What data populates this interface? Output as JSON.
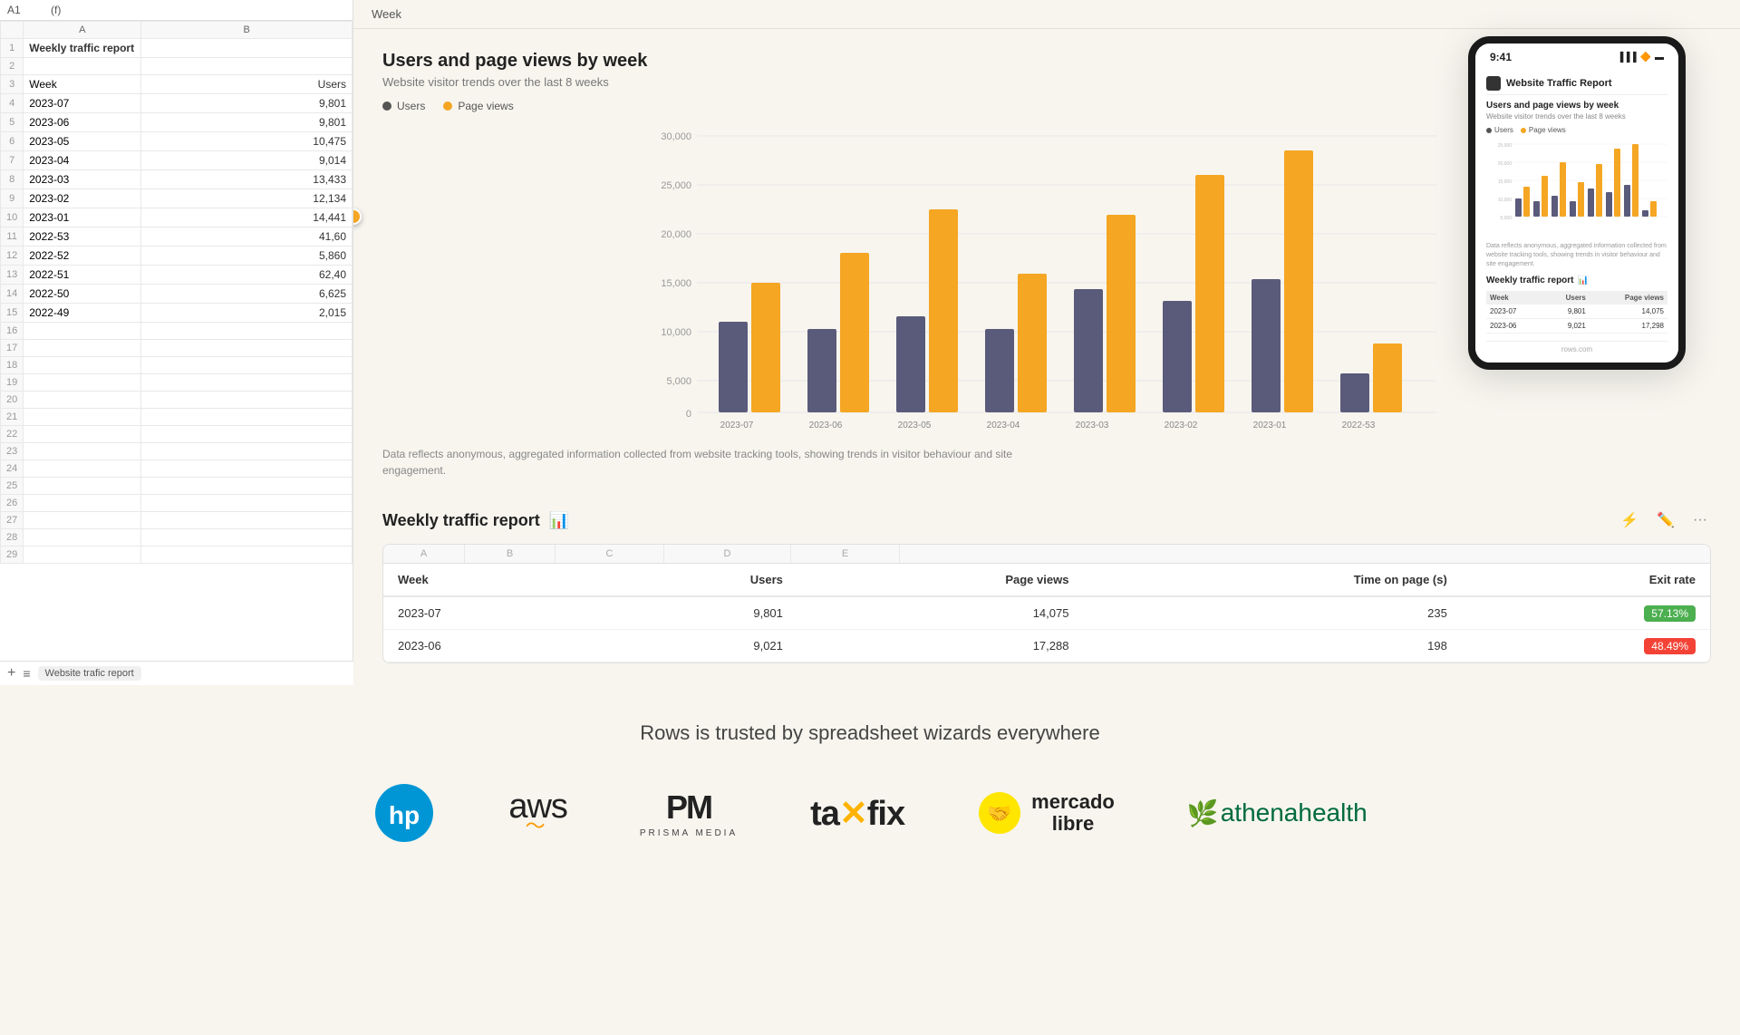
{
  "spreadsheet": {
    "cell_ref": "A1",
    "formula": "(f)",
    "col_a_header": "A",
    "col_b_header": "B",
    "rows": [
      {
        "num": 1,
        "a": "Weekly traffic report",
        "b": ""
      },
      {
        "num": 2,
        "a": "",
        "b": ""
      },
      {
        "num": 3,
        "a": "Week",
        "b": "Users"
      },
      {
        "num": 4,
        "a": "2023-07",
        "b": "9,801"
      },
      {
        "num": 5,
        "a": "2023-06",
        "b": "9,801"
      },
      {
        "num": 6,
        "a": "2023-05",
        "b": "10,475"
      },
      {
        "num": 7,
        "a": "2023-04",
        "b": "9,014"
      },
      {
        "num": 8,
        "a": "2023-03",
        "b": "13,433"
      },
      {
        "num": 9,
        "a": "2023-02",
        "b": "12,134"
      },
      {
        "num": 10,
        "a": "2023-01",
        "b": "14,441"
      },
      {
        "num": 11,
        "a": "2022-53",
        "b": "41,60"
      },
      {
        "num": 12,
        "a": "2022-52",
        "b": "5,860"
      },
      {
        "num": 13,
        "a": "2022-51",
        "b": "62,40"
      },
      {
        "num": 14,
        "a": "2022-50",
        "b": "6,625"
      },
      {
        "num": 15,
        "a": "2022-49",
        "b": "2,015"
      },
      {
        "num": 16,
        "a": "",
        "b": ""
      },
      {
        "num": 17,
        "a": "",
        "b": ""
      },
      {
        "num": 18,
        "a": "",
        "b": ""
      },
      {
        "num": 19,
        "a": "",
        "b": ""
      },
      {
        "num": 20,
        "a": "",
        "b": ""
      },
      {
        "num": 21,
        "a": "",
        "b": ""
      },
      {
        "num": 22,
        "a": "",
        "b": ""
      },
      {
        "num": 23,
        "a": "",
        "b": ""
      },
      {
        "num": 24,
        "a": "",
        "b": ""
      },
      {
        "num": 25,
        "a": "",
        "b": ""
      },
      {
        "num": 26,
        "a": "",
        "b": ""
      },
      {
        "num": 27,
        "a": "",
        "b": ""
      },
      {
        "num": 28,
        "a": "",
        "b": ""
      },
      {
        "num": 29,
        "a": "",
        "b": ""
      }
    ],
    "sheet_tab": "Website trafic report"
  },
  "chart": {
    "title": "Users and page views by week",
    "subtitle": "Website visitor trends over the last 8 weeks",
    "legend": {
      "users_label": "Users",
      "pageviews_label": "Page views"
    },
    "footnote": "Data reflects anonymous, aggregated information collected from website tracking tools, showing trends in visitor behaviour and site engagement.",
    "bars": [
      {
        "week": "2023-07",
        "users": 9801,
        "pageviews": 14075
      },
      {
        "week": "2023-06",
        "users": 9021,
        "pageviews": 17288
      },
      {
        "week": "2023-05",
        "users": 10475,
        "pageviews": 22000
      },
      {
        "week": "2023-04",
        "users": 9014,
        "pageviews": 15000
      },
      {
        "week": "2023-03",
        "users": 13433,
        "pageviews": 21500
      },
      {
        "week": "2023-02",
        "users": 12134,
        "pageviews": 25800
      },
      {
        "week": "2023-01",
        "users": 14441,
        "pageviews": 28500
      },
      {
        "week": "2022-53",
        "users": 4160,
        "pageviews": 7500
      }
    ],
    "y_labels": [
      "30,000",
      "25,000",
      "20,000",
      "15,000",
      "10,000",
      "5,000",
      "0"
    ],
    "max_value": 30000
  },
  "report": {
    "title": "Weekly traffic report",
    "col_letters": [
      "A",
      "B",
      "C",
      "D",
      "E"
    ],
    "columns": [
      "Week",
      "Users",
      "Page views",
      "Time on page (s)",
      "Exit rate"
    ],
    "rows": [
      {
        "week": "2023-07",
        "users": "9,801",
        "pageviews": "14,075",
        "time": "235",
        "exit_rate": "57.13%",
        "exit_class": "green"
      },
      {
        "week": "2023-06",
        "users": "9,021",
        "pageviews": "17,288",
        "time": "198",
        "exit_rate": "48.49%",
        "exit_class": "red"
      }
    ]
  },
  "phone": {
    "time": "9:41",
    "app_title": "Website Traffic Report",
    "chart_title": "Users and page views by week",
    "chart_subtitle": "Website visitor trends over the last 8 weeks",
    "legend_users": "Users",
    "legend_pageviews": "Page views",
    "footnote": "Data reflects anonymous, aggregated information collected from website tracking tools, showing trends in visitor behaviour and site engagement.",
    "report_title": "Weekly traffic report",
    "table_cols": [
      "Week",
      "Users",
      "Page views"
    ],
    "table_rows": [
      {
        "week": "2023-07",
        "users": "9,801",
        "pageviews": "14,075"
      },
      {
        "week": "2023-06",
        "users": "9,021",
        "pageviews": "17,298"
      }
    ],
    "footer": "rows.com"
  },
  "week_header": "Week",
  "trusted": {
    "title": "Rows is trusted by spreadsheet wizards everywhere",
    "logos": [
      "HP",
      "aws",
      "Prisma Media",
      "taxfix",
      "mercado libre",
      "athenahealth"
    ]
  }
}
